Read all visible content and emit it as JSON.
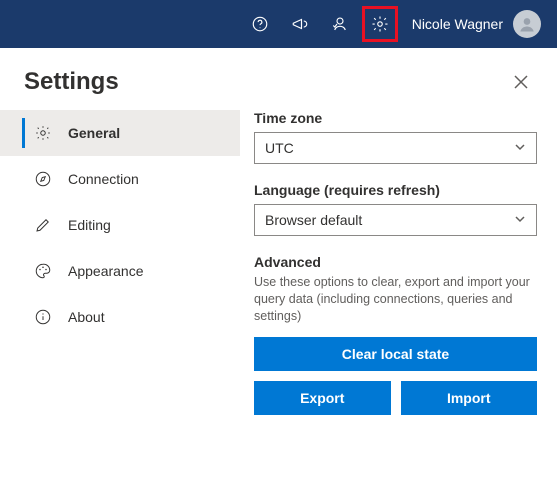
{
  "topbar": {
    "user_name": "Nicole Wagner"
  },
  "panel": {
    "title": "Settings"
  },
  "sidebar": {
    "items": [
      {
        "label": "General"
      },
      {
        "label": "Connection"
      },
      {
        "label": "Editing"
      },
      {
        "label": "Appearance"
      },
      {
        "label": "About"
      }
    ]
  },
  "main": {
    "timezone_label": "Time zone",
    "timezone_value": "UTC",
    "language_label": "Language (requires refresh)",
    "language_value": "Browser default",
    "advanced_title": "Advanced",
    "advanced_desc": "Use these options to clear, export and import your query data (including connections, queries and settings)",
    "clear_btn": "Clear local state",
    "export_btn": "Export",
    "import_btn": "Import"
  }
}
